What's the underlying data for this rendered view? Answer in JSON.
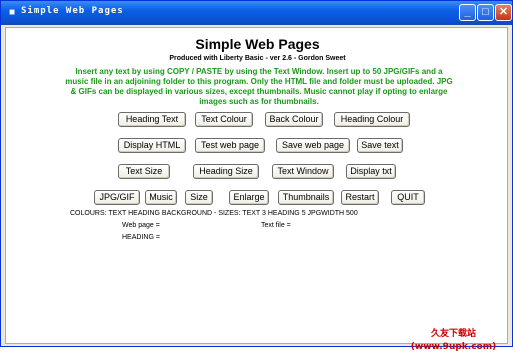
{
  "window": {
    "title": "Simple Web Pages"
  },
  "main": {
    "heading": "Simple Web Pages",
    "credit": "Produced with Liberty Basic - ver 2.6 - Gordon Sweet",
    "description": "Insert any text by using COPY / PASTE by using the Text Window. Insert up to 50 JPG/GIFs and a music file in an adjoining folder to this program. Only the HTML file and folder must be uploaded. JPG & GIFs can be displayed in various sizes, except thumbnails. Music cannot play if opting to enlarge images such as for thumbnails."
  },
  "buttons": {
    "heading_text": "Heading Text",
    "text_colour": "Text Colour",
    "back_colour": "Back Colour",
    "heading_colour": "Heading Colour",
    "display_html": "Display HTML",
    "test_web_page": "Test web page",
    "save_web_page": "Save web page",
    "save_text": "Save text",
    "text_size": "Text Size",
    "heading_size": "Heading Size",
    "text_window": "Text Window",
    "display_txt": "Display txt",
    "jpg_gif": "JPG/GIF",
    "music": "Music",
    "size": "Size",
    "enlarge": "Enlarge",
    "thumbnails": "Thumbnails",
    "restart": "Restart",
    "quit": "QUIT"
  },
  "status": {
    "settings": "COLOURS: TEXT HEADING BACKGROUND - SIZES: TEXT 3 HEADING 5 JPGWIDTH 500",
    "web_page": "Web page =",
    "text_file": "Text file =",
    "heading": "HEADING ="
  },
  "watermark": "久友下载站(www.9upk.com)"
}
